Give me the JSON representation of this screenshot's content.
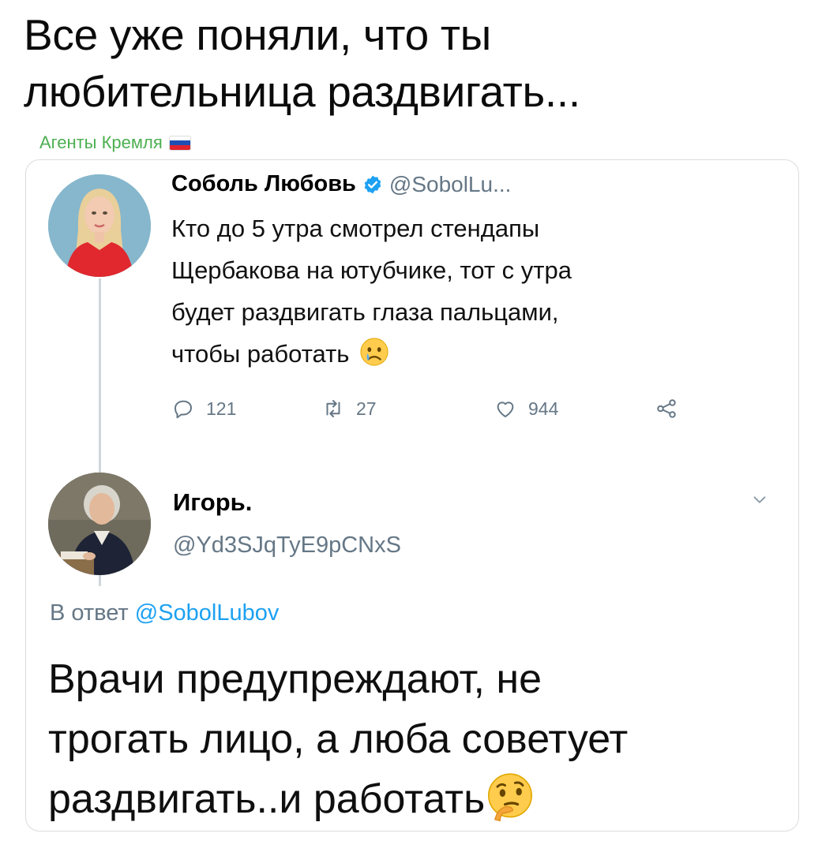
{
  "caption": {
    "line1": "Все уже поняли, что ты",
    "line2": "любительница раздвигать..."
  },
  "source": {
    "label": "Агенты Кремля",
    "flag_colors": [
      "#ffffff",
      "#1f4fb4",
      "#e0232e"
    ]
  },
  "tweet1": {
    "author_name": "Соболь Любовь",
    "verified": true,
    "handle": "@SobolLu...",
    "text_lines": [
      "Кто до 5 утра смотрел стендапы",
      "Щербакова на ютубчике, тот с утра",
      "будет раздвигать глаза пальцами,",
      "чтобы работать"
    ],
    "emoji": "crying-face",
    "actions": {
      "replies": "121",
      "retweets": "27",
      "likes": "944"
    }
  },
  "tweet2": {
    "author_name": "Игорь.",
    "handle": "@Yd3SJqTyE9pCNxS",
    "reply_prefix": "В ответ",
    "reply_mention": "@SobolLubov",
    "text_lines": [
      "Врачи предупреждают, не",
      "трогать лицо, а люба советует",
      "раздвигать..и работать"
    ],
    "emoji": "thinking-face"
  },
  "colors": {
    "source_green": "#4caf50",
    "muted_gray": "#657786",
    "twitter_blue": "#1da1f2",
    "thread_line": "#cfd6dc"
  }
}
